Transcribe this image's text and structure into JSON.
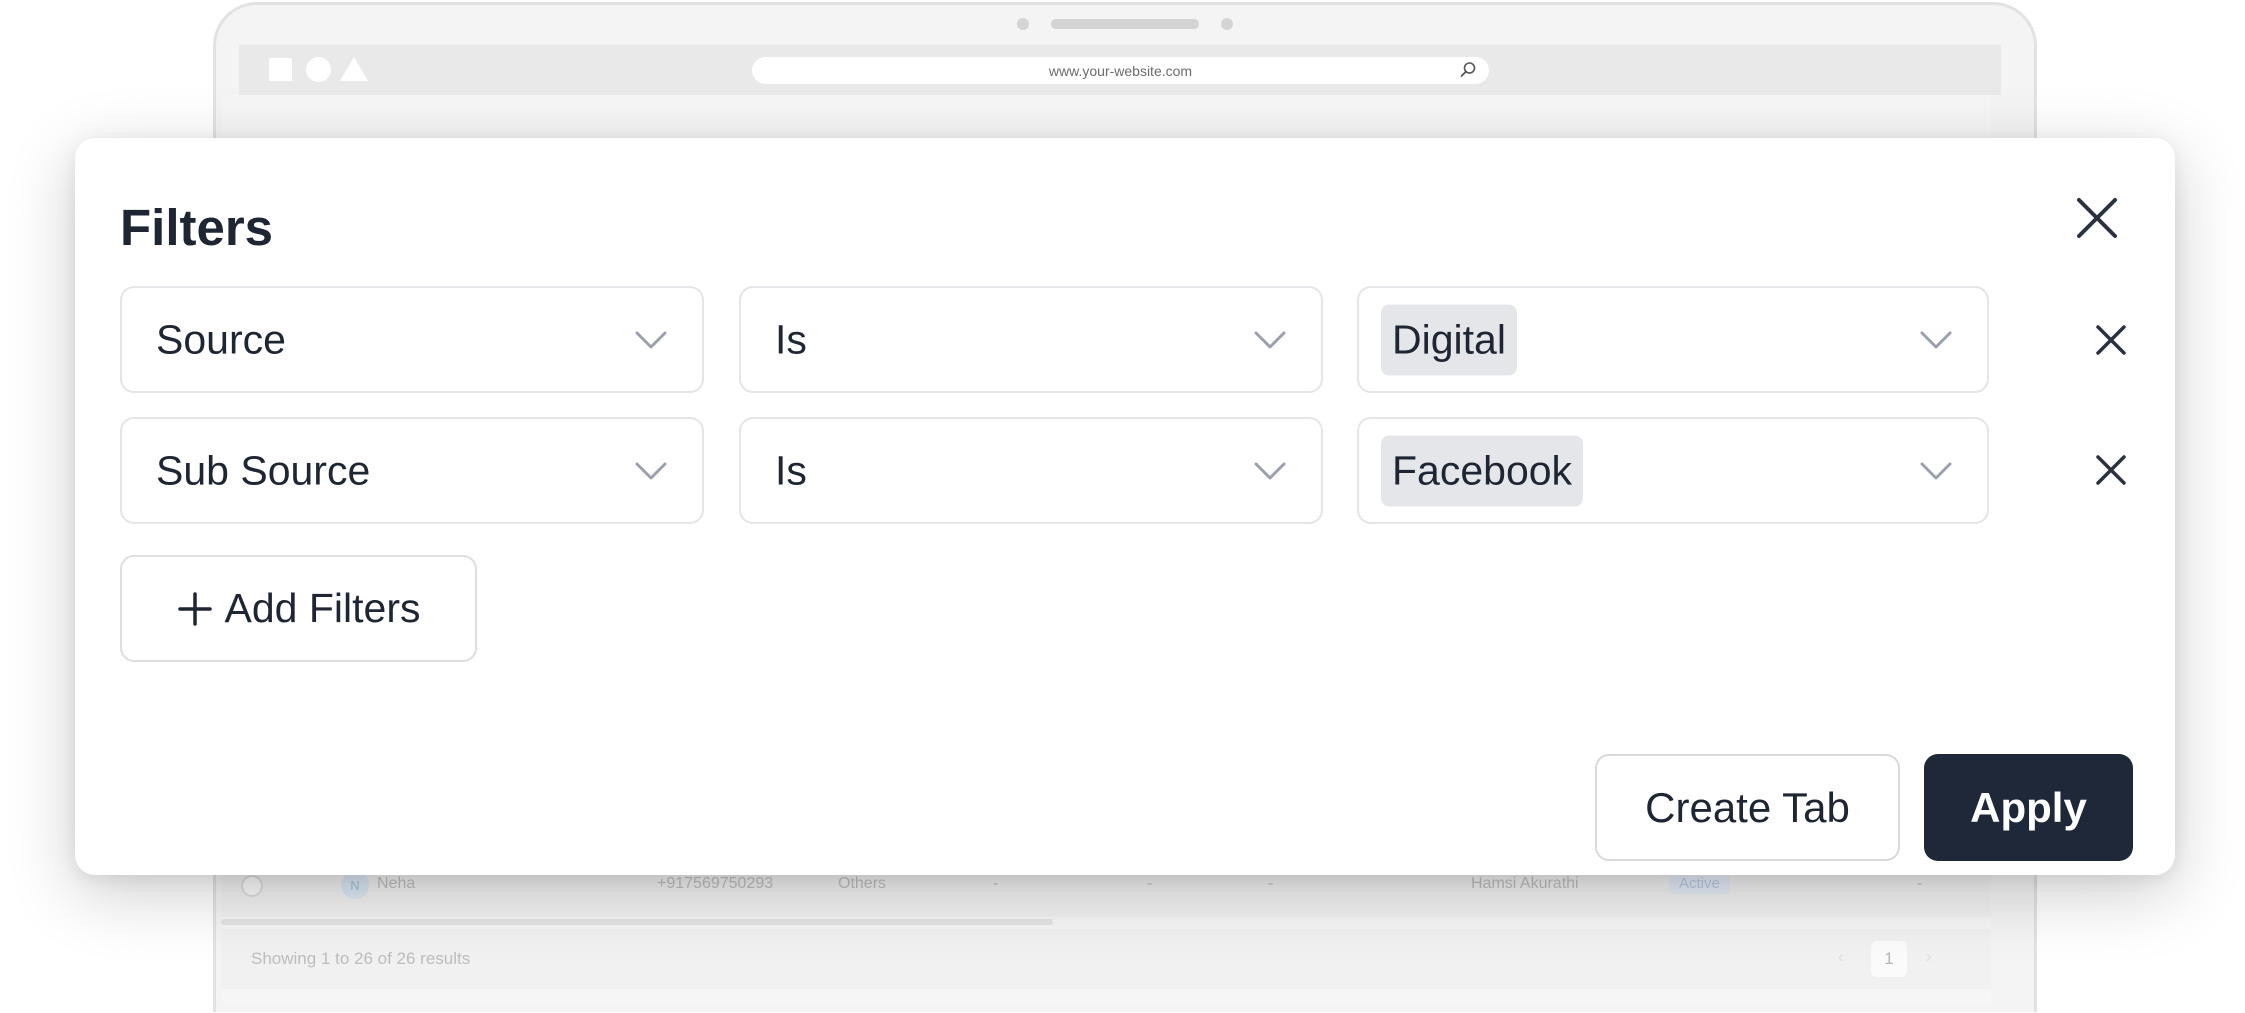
{
  "browser": {
    "url": "www.your-website.com",
    "icons": [
      "square-icon",
      "circle-icon",
      "triangle-icon",
      "search-icon"
    ]
  },
  "background_table": {
    "row": {
      "avatar_initial": "N",
      "name": "Neha",
      "phone": "+917569750293",
      "source": "Others",
      "col5": "-",
      "col6": "-",
      "col7": "-",
      "owner": "Hamsi Akurathi",
      "status": "Active",
      "col10": "-"
    },
    "footer_text": "Showing 1 to 26 of 26 results",
    "current_page": "1"
  },
  "modal": {
    "title": "Filters",
    "filters": [
      {
        "field": "Source",
        "operator": "Is",
        "value": "Digital"
      },
      {
        "field": "Sub Source",
        "operator": "Is",
        "value": "Facebook"
      }
    ],
    "add_filters_label": "Add Filters",
    "create_tab_label": "Create Tab",
    "apply_label": "Apply"
  },
  "colors": {
    "text_dark": "#1e2533",
    "apply_bg": "#1e2838",
    "chip_bg": "#e5e6ea",
    "border": "#e3e5e8",
    "chevron": "#9aa1ad"
  }
}
